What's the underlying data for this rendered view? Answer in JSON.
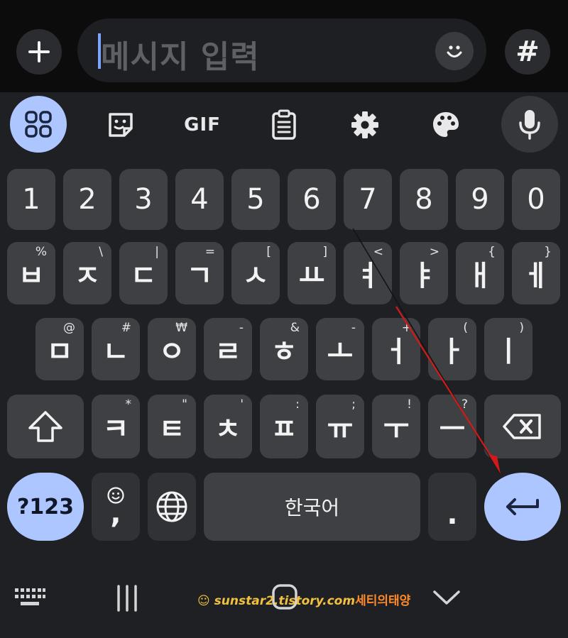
{
  "message_bar": {
    "placeholder": "메시지 입력",
    "plus_label": "+",
    "hash_label": "#"
  },
  "toolbar": {
    "gif_label": "GIF",
    "icons": [
      "apps-grid-icon",
      "sticker-icon",
      "gif-icon",
      "clipboard-icon",
      "settings-gear-icon",
      "palette-icon",
      "microphone-icon"
    ]
  },
  "keyboard": {
    "number_row": [
      "1",
      "2",
      "3",
      "4",
      "5",
      "6",
      "7",
      "8",
      "9",
      "0"
    ],
    "row1": [
      {
        "main": "ㅂ",
        "hint": "%"
      },
      {
        "main": "ㅈ",
        "hint": "\\"
      },
      {
        "main": "ㄷ",
        "hint": "|"
      },
      {
        "main": "ㄱ",
        "hint": "="
      },
      {
        "main": "ㅅ",
        "hint": "["
      },
      {
        "main": "ㅛ",
        "hint": "]"
      },
      {
        "main": "ㅕ",
        "hint": "<"
      },
      {
        "main": "ㅑ",
        "hint": ">"
      },
      {
        "main": "ㅐ",
        "hint": "{"
      },
      {
        "main": "ㅔ",
        "hint": "}"
      }
    ],
    "row2": [
      {
        "main": "ㅁ",
        "hint": "@"
      },
      {
        "main": "ㄴ",
        "hint": "#"
      },
      {
        "main": "ㅇ",
        "hint": "₩"
      },
      {
        "main": "ㄹ",
        "hint": "-"
      },
      {
        "main": "ㅎ",
        "hint": "&"
      },
      {
        "main": "ㅗ",
        "hint": "-"
      },
      {
        "main": "ㅓ",
        "hint": "+"
      },
      {
        "main": "ㅏ",
        "hint": "("
      },
      {
        "main": "ㅣ",
        "hint": ")"
      }
    ],
    "row3": [
      {
        "main": "ㅋ",
        "hint": "*"
      },
      {
        "main": "ㅌ",
        "hint": "\""
      },
      {
        "main": "ㅊ",
        "hint": "'"
      },
      {
        "main": "ㅍ",
        "hint": ":"
      },
      {
        "main": "ㅠ",
        "hint": ";"
      },
      {
        "main": "ㅜ",
        "hint": "!"
      },
      {
        "main": "ㅡ",
        "hint": "?"
      }
    ],
    "symbols_label": "?123",
    "comma_label": ",",
    "space_label": "한국어",
    "period_label": "."
  },
  "nav": {
    "watermark_en": "sunstar2.tistory.com",
    "watermark_kr": "세티의태양"
  },
  "colors": {
    "accent_blue": "#aec6ff",
    "key_bg": "#3f4043",
    "background": "#1f2023",
    "annotation_arrow": "#d11a1a"
  }
}
